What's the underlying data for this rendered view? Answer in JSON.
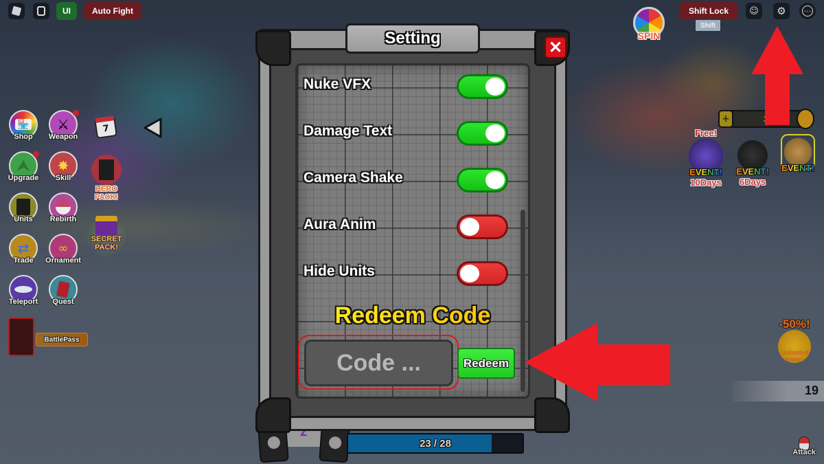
{
  "top_bar": {
    "left": {
      "roblox_menu_icon": "roblox-logo-icon",
      "chat_icon": "chat-icon",
      "ui_label": "UI",
      "auto_fight_label": "Auto Fight"
    },
    "right": {
      "spin_label": "SPIN",
      "shift_lock_label": "Shift Lock",
      "shift_key_label": "Shift",
      "emotes_icon": "emotes-icon",
      "settings_icon": "gear-icon",
      "more_icon": "more-icon"
    }
  },
  "left_menu": {
    "items": [
      {
        "label": "Shop",
        "icon": "shop-icon",
        "notification": false
      },
      {
        "label": "Weapon",
        "icon": "weapon-icon",
        "notification": true
      },
      {
        "label": "Upgrade",
        "icon": "upgrade-icon",
        "notification": true
      },
      {
        "label": "Skill",
        "icon": "skill-icon",
        "notification": false
      },
      {
        "label": "Units",
        "icon": "units-icon",
        "notification": false
      },
      {
        "label": "Rebirth",
        "icon": "rebirth-icon",
        "notification": false
      },
      {
        "label": "Trade",
        "icon": "trade-icon",
        "notification": false
      },
      {
        "label": "Ornament",
        "icon": "ornament-icon",
        "notification": false
      },
      {
        "label": "Teleport",
        "icon": "teleport-icon",
        "notification": false
      },
      {
        "label": "Quest",
        "icon": "quest-icon",
        "notification": false
      }
    ],
    "daily_calendar_day": "7",
    "hero_pack_label": "HERO PACK!",
    "secret_pack_label": "SECRET PACK!",
    "battlepass_label": "BattlePass",
    "collapse_icon": "triangle-left-icon"
  },
  "settings_panel": {
    "title": "Setting",
    "close_label": "✕",
    "settings": [
      {
        "label": "Nuke VFX",
        "enabled": true
      },
      {
        "label": "Damage Text",
        "enabled": true
      },
      {
        "label": "Camera Shake",
        "enabled": true
      },
      {
        "label": "Aura Anim",
        "enabled": false
      },
      {
        "label": "Hide Units",
        "enabled": false
      }
    ],
    "redeem": {
      "title": "Redeem Code",
      "input_placeholder": "Code ...",
      "input_value": "",
      "button_label": "Redeem"
    }
  },
  "right_side": {
    "currency_value": "3",
    "events": [
      {
        "top_label": "Free!",
        "tag": "EVENT!",
        "days": "10Days"
      },
      {
        "top_label": "",
        "tag": "EVENT!",
        "days": "6Days"
      },
      {
        "top_label": "",
        "tag": "EVENT!",
        "days": ""
      }
    ],
    "ammo_discount": "-50%!",
    "ammo_label": "Unlimited Ammo",
    "counter_value": "19",
    "attack_label": "Attack"
  },
  "bottom": {
    "progress_text": "23 / 28",
    "progress_current": 23,
    "progress_max": 28
  },
  "annotations": {
    "arrow_color": "#ee1c24"
  }
}
